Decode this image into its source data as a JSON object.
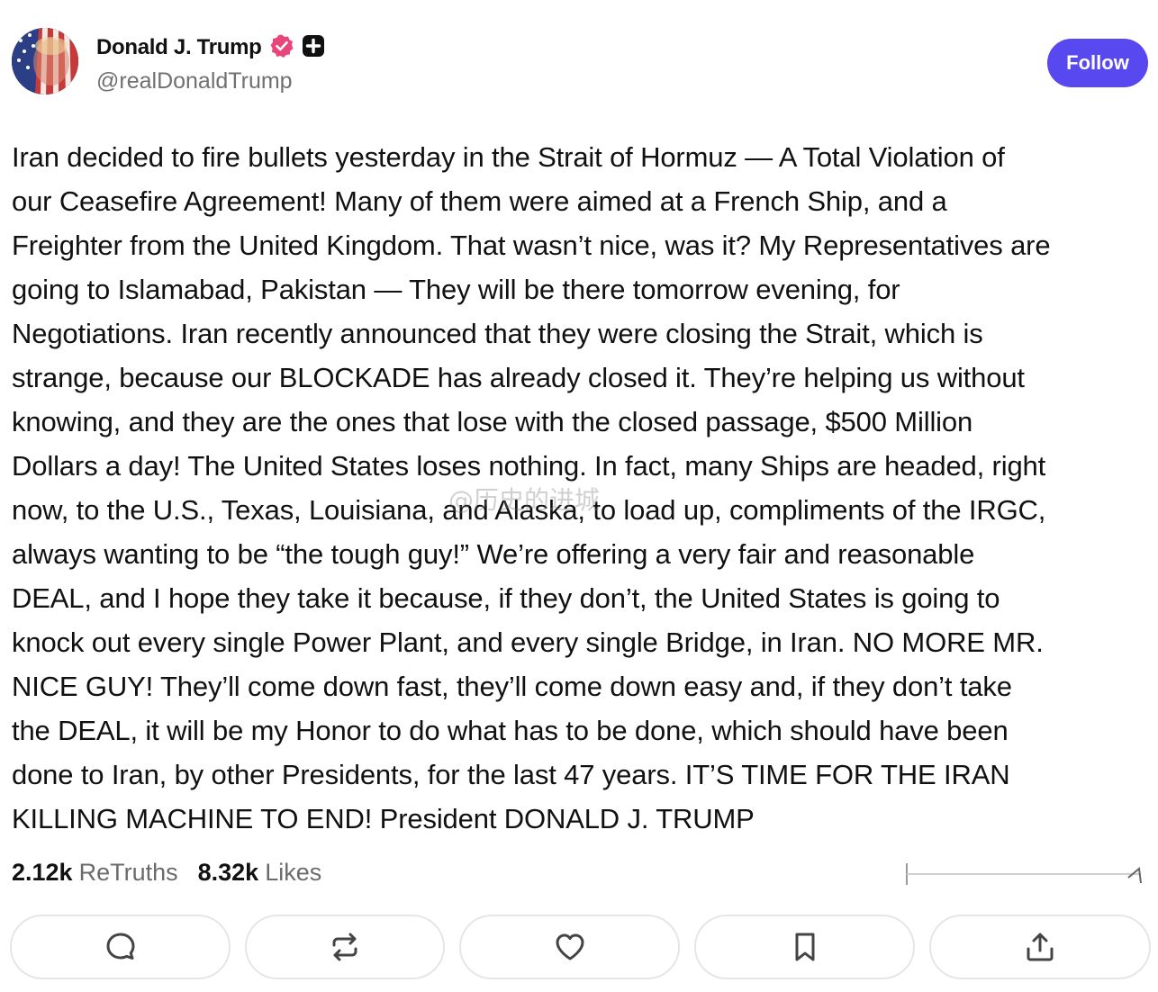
{
  "header": {
    "display_name": "Donald J. Trump",
    "handle": "@realDonaldTrump",
    "follow_label": "Follow",
    "icons": [
      "verified-badge-icon",
      "plus-badge-icon"
    ]
  },
  "post": {
    "lines": [
      "Iran decided to fire bullets yesterday in the Strait of Hormuz — A Total Violation of",
      "our Ceasefire Agreement! Many of them were aimed at a French Ship, and a",
      "Freighter from the United Kingdom. That wasn’t nice, was it? My Representatives are",
      "going to Islamabad, Pakistan — They will be there tomorrow evening, for",
      "Negotiations. Iran recently announced that they were closing the Strait, which is",
      "strange, because our BLOCKADE has already closed it. They’re helping us without",
      "knowing, and they are the ones that lose with the closed passage, $500 Million",
      "Dollars a day! The United States loses nothing. In fact, many Ships are headed, right",
      "now, to the U.S., Texas, Louisiana, and Alaska, to load up, compliments of the IRGC,",
      "always wanting to be “the tough guy!” We’re offering a very fair and reasonable",
      "DEAL, and I hope they take it because, if they don’t, the United States is going to",
      "knock out every single Power Plant, and every single Bridge, in Iran. NO MORE MR.",
      "NICE GUY! They’ll come down fast, they’ll come down easy and, if they don’t take",
      "the DEAL, it will be my Honor to do what has to be done, which should have been",
      "done to Iran, by other Presidents, for the last 47 years. IT’S TIME FOR THE IRAN",
      "KILLING MACHINE TO END! President DONALD J. TRUMP"
    ],
    "watermark": "@历史的进城"
  },
  "stats": {
    "retruths_count": "2.12k",
    "retruths_label": "ReTruths",
    "likes_count": "8.32k",
    "likes_label": "Likes"
  },
  "actions": [
    {
      "name": "reply",
      "icon": "comment-icon"
    },
    {
      "name": "retruth",
      "icon": "repost-icon"
    },
    {
      "name": "like",
      "icon": "heart-icon"
    },
    {
      "name": "bookmark",
      "icon": "bookmark-icon"
    },
    {
      "name": "share",
      "icon": "share-icon"
    }
  ],
  "colors": {
    "accent": "#5848f0",
    "verified": "#e8457a",
    "text": "#111111",
    "muted": "#707070"
  }
}
